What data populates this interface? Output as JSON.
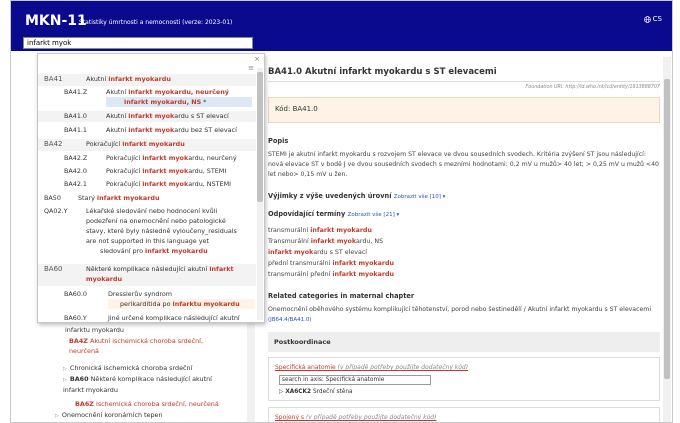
{
  "header": {
    "brand": "MKN-11",
    "subtitle": "Statistiky úmrtnosti a nemocnosti (verze: 2023-01)",
    "lang_label": "CS",
    "search_value": "infarkt myok",
    "colors": {
      "header_bg": "#0a0a8e",
      "highlight": "#c0392b",
      "link": "#2955b8"
    }
  },
  "tree": [
    {
      "text": "infarktu myokardu",
      "indent": 40
    },
    {
      "code": "BA4Z",
      "text": "Akutní ischemická choroba srdeční, neurčená"
    },
    {
      "text": "Chronická ischemická choroba srdeční",
      "tri": true
    },
    {
      "code": "BA60",
      "text": "Některé komplikace následující akutní infarkt myokardu",
      "tri": true
    },
    {
      "code": "BA6Z",
      "text": "Ischemická choroba srdeční, neurčená"
    },
    {
      "text": "Onemocnění koronárních tepen",
      "tri": true
    }
  ],
  "dropdown": {
    "items": [
      {
        "code": "BA41",
        "pre": "Akutní ",
        "hl": "infarkt myok",
        "post": "ardu"
      },
      {
        "code": "BA41.Z",
        "pre": "Akutní ",
        "hl": "infarkt myok",
        "post": "ardu, neurčený",
        "line2_hl": "infarkt myok",
        "line2_post": "ardu, NS"
      },
      {
        "code": "BA41.0",
        "pre": "Akutní ",
        "hl": "infarkt myok",
        "post": "ardu s ST elevací"
      },
      {
        "code": "BA41.1",
        "pre": "Akutní ",
        "hl": "infarkt myok",
        "post": "ardu bez ST elevací"
      },
      {
        "code": "BA42",
        "pre": "Pokračující ",
        "hl": "infarkt myok",
        "post": "ardu"
      },
      {
        "code": "BA42.Z",
        "pre": "Pokračující ",
        "hl": "infarkt myok",
        "post": "ardu, neurčený"
      },
      {
        "code": "BA42.0",
        "pre": "Pokračující ",
        "hl": "infarkt myok",
        "post": "ardu, STEMI"
      },
      {
        "code": "BA42.1",
        "pre": "Pokračující ",
        "hl": "infarkt myok",
        "post": "ardu, NSTEMI"
      },
      {
        "code": "BA50",
        "pre": "Starý ",
        "hl": "infarkt myok",
        "post": "ardu"
      },
      {
        "code": "QA02.Y",
        "lines": [
          "Lékařské sledování nebo hodnocení kvůli",
          "podezření na onemocnění nebo patologické",
          "stavy, které byly následně vyloučeny_residuals",
          "are not supported in this language yet"
        ],
        "last_pre": "sledování pro ",
        "last_hl": "infarkt myok",
        "last_post": "ardu"
      },
      {
        "code": "BA60",
        "pre": "Některé komplikace následující akutní ",
        "hl": "infarkt",
        "line2_hl": "myok",
        "line2_post": "ardu"
      },
      {
        "code": "BA60.0",
        "pre": "Dresslerův syndrom",
        "line2_pre": "perikarditida po ",
        "line2_hl": "infarktu myok",
        "line2_post": "ardu"
      },
      {
        "code": "BA60.Y",
        "pre": "Jiné určené komplikace následující akutní"
      }
    ],
    "close": "×",
    "menu_icon": "≡"
  },
  "detail": {
    "title": "BA41.0 Akutní infarkt myokardu s ST elevacemi",
    "foundation_uri": "Foundation URI: http://id.who.int/icd/entity/1913888707",
    "kod_label": "Kód:",
    "kod_value": "BA41.0",
    "popis_h": "Popis",
    "popis_text": "STEMI je akutní infarkt myokardu s rozvojem ST elevace ve dvou sousedních svodech. Kritéria zvýšení ST jsou následující: nová elevace ST v bodě J ve dvou sousedních svodech s mezními hodnotami: 0,2 mV u mužů> 40 let; > 0,25 mV u mužů <40 let nebo> 0,15 mV u žen.",
    "vyjimky_h": "Výjimky z výše uvedených úrovní",
    "vyjimky_link": "Zobrazit vše [10] ▾",
    "terminy_h": "Odpovídající termíny",
    "terminy_link": "Zobrazit vše [21] ▾",
    "terms": [
      {
        "pre": "transmurální ",
        "hl": "infarkt myok",
        "post": "ardu"
      },
      {
        "pre": "Transmurální ",
        "hl": "infarkt myok",
        "post": "ardu, NS"
      },
      {
        "pre": "",
        "hl": "infarkt myok",
        "post": "ardu s ST elevací"
      },
      {
        "pre": "přední transmurální ",
        "hl": "infarkt myok",
        "post": "ardu"
      },
      {
        "pre": "transmurální přední ",
        "hl": "infarkt myok",
        "post": "ardu"
      }
    ],
    "related_h": "Related categories in maternal chapter",
    "related_text": "Onemocnění oběhového systému komplikující těhotenství, porod nebo šestinedělí / Akutní infarkt myokardu s ST elevacemi",
    "related_link": "(JB64.4/BA41.0)",
    "postkoord_h": "Postkoordinace",
    "box1_label": "Specifická anatomie",
    "box1_hint": " (v případě potřeby použijte dodatečný kód)",
    "box1_placeholder": "search in axis: Specifická anatomie",
    "box1_sub_code": "XA6CK2",
    "box1_sub_text": "Srdeční stěna",
    "box2_label": "Spojený s",
    "box2_hint": " (v případě potřeby použijte dodatečný kód)"
  }
}
